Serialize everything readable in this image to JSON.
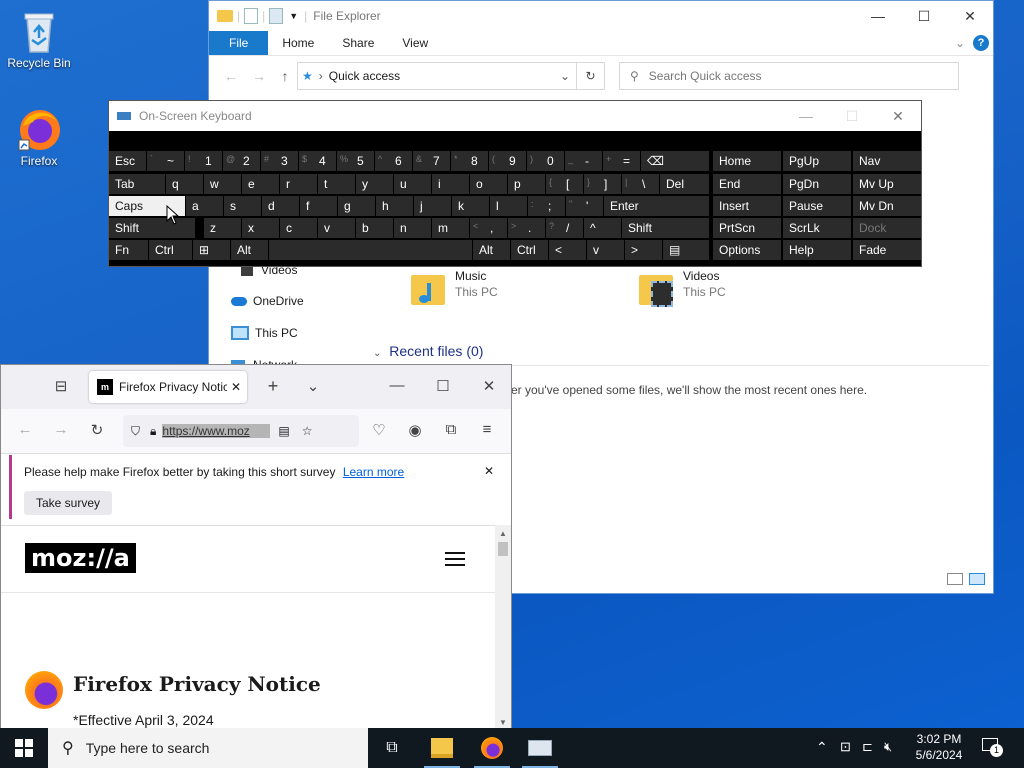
{
  "desktop": {
    "icons": [
      {
        "label": "Recycle Bin"
      },
      {
        "label": "Firefox"
      }
    ]
  },
  "explorer": {
    "title": "File Explorer",
    "ribbon_tabs": [
      "File",
      "Home",
      "Share",
      "View"
    ],
    "address": "Quick access",
    "search_placeholder": "Search Quick access",
    "nav_items": [
      "Videos",
      "OneDrive",
      "This PC",
      "Network"
    ],
    "folders": [
      {
        "name": "Music",
        "location": "This PC"
      },
      {
        "name": "Videos",
        "location": "This PC"
      }
    ],
    "recent_header": "Recent files (0)",
    "recent_empty": "er you've opened some files, we'll show the most recent ones here."
  },
  "osk": {
    "title": "On-Screen Keyboard",
    "rows": [
      [
        {
          "l": "Esc"
        },
        {
          "l": "~",
          "s": "`"
        },
        {
          "l": "1",
          "s": "!"
        },
        {
          "l": "2",
          "s": "@"
        },
        {
          "l": "3",
          "s": "#"
        },
        {
          "l": "4",
          "s": "$"
        },
        {
          "l": "5",
          "s": "%"
        },
        {
          "l": "6",
          "s": "^"
        },
        {
          "l": "7",
          "s": "&"
        },
        {
          "l": "8",
          "s": "*"
        },
        {
          "l": "9",
          "s": "("
        },
        {
          "l": "0",
          "s": ")"
        },
        {
          "l": "-",
          "s": "_"
        },
        {
          "l": "=",
          "s": "+"
        },
        {
          "l": "⌫"
        }
      ],
      [
        {
          "l": "Tab"
        },
        {
          "l": "q"
        },
        {
          "l": "w"
        },
        {
          "l": "e"
        },
        {
          "l": "r"
        },
        {
          "l": "t"
        },
        {
          "l": "y"
        },
        {
          "l": "u"
        },
        {
          "l": "i"
        },
        {
          "l": "o"
        },
        {
          "l": "p"
        },
        {
          "l": "[",
          "s": "{"
        },
        {
          "l": "]",
          "s": "}"
        },
        {
          "l": "\\",
          "s": "|"
        },
        {
          "l": "Del"
        }
      ],
      [
        {
          "l": "Caps"
        },
        {
          "l": "a"
        },
        {
          "l": "s"
        },
        {
          "l": "d"
        },
        {
          "l": "f"
        },
        {
          "l": "g"
        },
        {
          "l": "h"
        },
        {
          "l": "j"
        },
        {
          "l": "k"
        },
        {
          "l": "l"
        },
        {
          "l": ";",
          "s": ":"
        },
        {
          "l": "'",
          "s": "\""
        },
        {
          "l": "Enter"
        }
      ],
      [
        {
          "l": "Shift"
        },
        {
          "l": "z"
        },
        {
          "l": "x"
        },
        {
          "l": "c"
        },
        {
          "l": "v"
        },
        {
          "l": "b"
        },
        {
          "l": "n"
        },
        {
          "l": "m"
        },
        {
          "l": ",",
          "s": "<"
        },
        {
          "l": ".",
          "s": ">"
        },
        {
          "l": "/",
          "s": "?"
        },
        {
          "l": "^"
        },
        {
          "l": "Shift"
        }
      ],
      [
        {
          "l": "Fn"
        },
        {
          "l": "Ctrl"
        },
        {
          "l": "⊞"
        },
        {
          "l": "Alt"
        },
        {
          "l": ""
        },
        {
          "l": "Alt"
        },
        {
          "l": "Ctrl"
        },
        {
          "l": "<"
        },
        {
          "l": "v"
        },
        {
          "l": ">"
        },
        {
          "l": "▤"
        }
      ]
    ],
    "right_keys": [
      [
        "Home",
        "PgUp",
        "Nav"
      ],
      [
        "End",
        "PgDn",
        "Mv Up"
      ],
      [
        "Insert",
        "Pause",
        "Mv Dn"
      ],
      [
        "PrtScn",
        "ScrLk",
        "Dock"
      ],
      [
        "Options",
        "Help",
        "Fade"
      ]
    ]
  },
  "firefox": {
    "tab_title": "Firefox Privacy Notic",
    "url": "https://www.moz",
    "survey_text": "Please help make Firefox better by taking this short survey",
    "survey_link": "Learn more",
    "survey_button": "Take survey",
    "logo_text": "moz://a",
    "page_title": "Firefox Privacy Notice",
    "effective": "*Effective April 3, 2024"
  },
  "taskbar": {
    "search_placeholder": "Type here to search",
    "time": "3:02 PM",
    "date": "5/6/2024",
    "notification_count": "1"
  }
}
